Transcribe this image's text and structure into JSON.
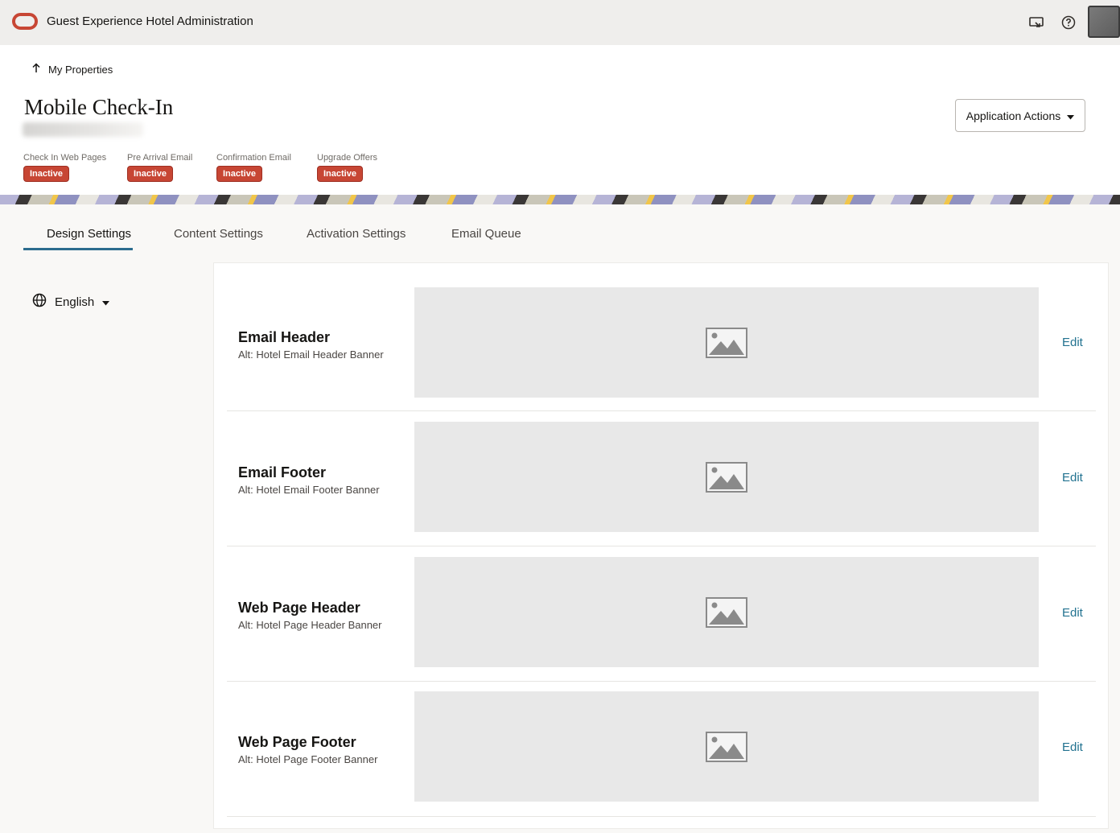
{
  "topbar": {
    "app_title": "Guest Experience Hotel Administration",
    "icons": [
      "screen-share-icon",
      "help-icon"
    ],
    "brand_color": "#c74634"
  },
  "header": {
    "back_label": "My Properties",
    "page_title": "Mobile Check-In",
    "app_actions_label": "Application Actions",
    "statuses": [
      {
        "label": "Check In Web Pages",
        "status": "Inactive"
      },
      {
        "label": "Pre Arrival Email",
        "status": "Inactive"
      },
      {
        "label": "Confirmation Email",
        "status": "Inactive"
      },
      {
        "label": "Upgrade Offers",
        "status": "Inactive"
      }
    ]
  },
  "tabs": [
    {
      "label": "Design Settings",
      "active": true
    },
    {
      "label": "Content Settings",
      "active": false
    },
    {
      "label": "Activation Settings",
      "active": false
    },
    {
      "label": "Email Queue",
      "active": false
    }
  ],
  "language": {
    "selected": "English"
  },
  "sections": [
    {
      "title": "Email Header",
      "alt": "Alt: Hotel Email Header Banner",
      "edit_label": "Edit"
    },
    {
      "title": "Email Footer",
      "alt": "Alt: Hotel Email Footer Banner",
      "edit_label": "Edit"
    },
    {
      "title": "Web Page Header",
      "alt": "Alt: Hotel Page Header Banner",
      "edit_label": "Edit"
    },
    {
      "title": "Web Page Footer",
      "alt": "Alt: Hotel Page Footer Banner",
      "edit_label": "Edit"
    }
  ]
}
